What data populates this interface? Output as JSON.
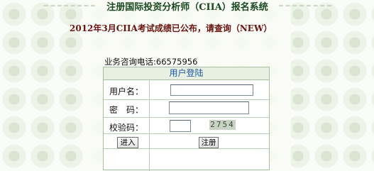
{
  "header": {
    "title": "注册国际投资分析师（CIIA）报名系统"
  },
  "notice": "2012年3月CIIA考试成绩已公布，请查询（NEW）",
  "contact": {
    "phone_text": "业务咨询电话:66575956"
  },
  "login": {
    "title": "用户登陆",
    "username_label": "用户名：",
    "username_value": "",
    "password_label": "密　码：",
    "password_value": "",
    "captcha_label": "校验码：",
    "captcha_value": "",
    "captcha_code": "2754",
    "login_button": "进入",
    "register_button": "注册"
  },
  "colors": {
    "title_text": "#18481e",
    "notice_text": "#6a1410",
    "login_title_text": "#1e58a8",
    "panel_border": "#a7bea0"
  }
}
